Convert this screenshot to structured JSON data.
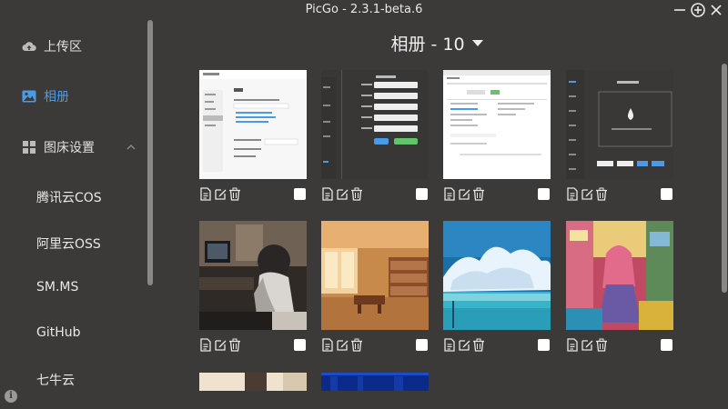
{
  "window": {
    "title": "PicGo - 2.3.1-beta.6"
  },
  "sidebar": {
    "items": [
      {
        "label": "上传区",
        "icon": "cloud-upload-icon"
      },
      {
        "label": "相册",
        "icon": "image-icon",
        "active": true
      },
      {
        "label": "图床设置",
        "icon": "grid-icon"
      }
    ],
    "sub_items": [
      "腾讯云COS",
      "阿里云OSS",
      "SM.MS",
      "GitHub",
      "七牛云"
    ]
  },
  "album": {
    "title": "相册 - 10"
  },
  "gallery": {
    "images": [
      {
        "kind": "screenshot-settings"
      },
      {
        "kind": "screenshot-form"
      },
      {
        "kind": "screenshot-table"
      },
      {
        "kind": "screenshot-upload"
      },
      {
        "kind": "anime-desk"
      },
      {
        "kind": "anime-room"
      },
      {
        "kind": "clouds-sea"
      },
      {
        "kind": "anime-colorful"
      },
      {
        "kind": "partial-light"
      },
      {
        "kind": "partial-blue"
      }
    ],
    "action_icons": [
      "document-icon",
      "edit-icon",
      "trash-icon"
    ]
  },
  "colors": {
    "background": "#3c3a38",
    "accent": "#4a9be6",
    "text": "#e0e0e0"
  }
}
